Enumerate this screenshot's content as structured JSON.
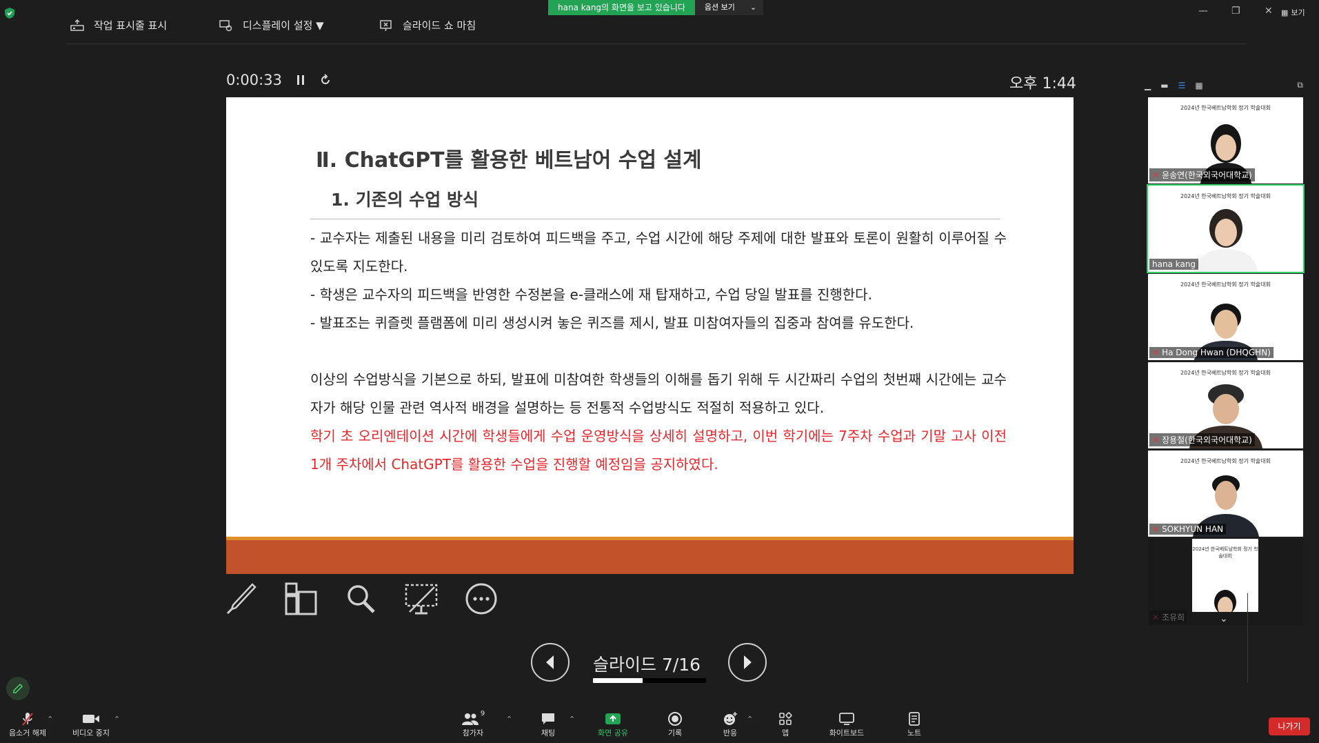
{
  "banner": {
    "sharing": "hana kang의 화면을 보고 있습니다",
    "options": "옵션 보기",
    "view": "보기"
  },
  "toolbar": {
    "show_taskbar": "작업 표시줄 표시",
    "display_settings": "디스플레이 설정 ▼",
    "end_slideshow": "슬라이드 쇼 마침"
  },
  "presentation": {
    "elapsed": "0:00:33",
    "clock": "오후 1:44",
    "slide_label": "슬라이드 7/16",
    "progress": 0.4375
  },
  "slide": {
    "title": "Ⅱ. ChatGPT를 활용한 베트남어 수업 설계",
    "subtitle": "1. 기존의 수업 방식",
    "bullets": [
      " - 교수자는 제출된 내용을 미리 검토하여 피드백을 주고, 수업 시간에 해당 주제에 대한 발표와 토론이 원활히 이루어질 수 있도록 지도한다.",
      " - 학생은 교수자의 피드백을 반영한 수정본을 e-클래스에 재 탑재하고, 수업 당일 발표를 진행한다.",
      " - 발표조는 퀴즐렛 플램폼에 미리 생성시켜 놓은 퀴즈를 제시, 발표 미참여자들의 집중과 참여를 유도한다."
    ],
    "paragraph": "  이상의 수업방식을 기본으로 하되, 발표에 미참여한 학생들의 이해를 돕기 위해 두 시간짜리 수업의 첫번째 시간에는 교수자가 해당 인물 관련 역사적 배경을 설명하는 등 전통적 수업방식도 적절히 적용하고 있다.",
    "highlight": "  학기 초 오리엔테이션 시간에 학생들에게 수업 운영방식을 상세히 설명하고, 이번 학기에는 7주차 수업과 기말 고사 이전 1개 주차에서 ChatGPT를 활용한 수업을 진행할 예정임을 공지하였다."
  },
  "participants": {
    "banner": "2024년 한국베트남학회 정기 학술대회",
    "tiles": [
      {
        "name": "윤송연(한국외국어대학교)",
        "muted": true
      },
      {
        "name": "hana kang",
        "muted": false
      },
      {
        "name": "Ha Dong Hwan (DHQGHN)",
        "muted": true
      },
      {
        "name": "장용철(한국외국어대학교)",
        "muted": true
      },
      {
        "name": "SOKHYUN HAN",
        "muted": true
      },
      {
        "name": "조유희",
        "muted": true
      }
    ]
  },
  "bottom_bar": {
    "unmute": "음소거 해제",
    "video": "비디오 중지",
    "participants": "참가자",
    "participants_count": "9",
    "chat": "채팅",
    "share": "화면 공유",
    "record": "기록",
    "reactions": "반응",
    "apps": "앱",
    "whiteboard": "화이트보드",
    "notes": "노트",
    "leave": "나가기"
  },
  "colors": {
    "share_green": "#23a455",
    "slide_band": "#c0532a",
    "slide_band_top": "#e09028",
    "highlight_red": "#e8262b",
    "leave_red": "#d52a2a"
  }
}
